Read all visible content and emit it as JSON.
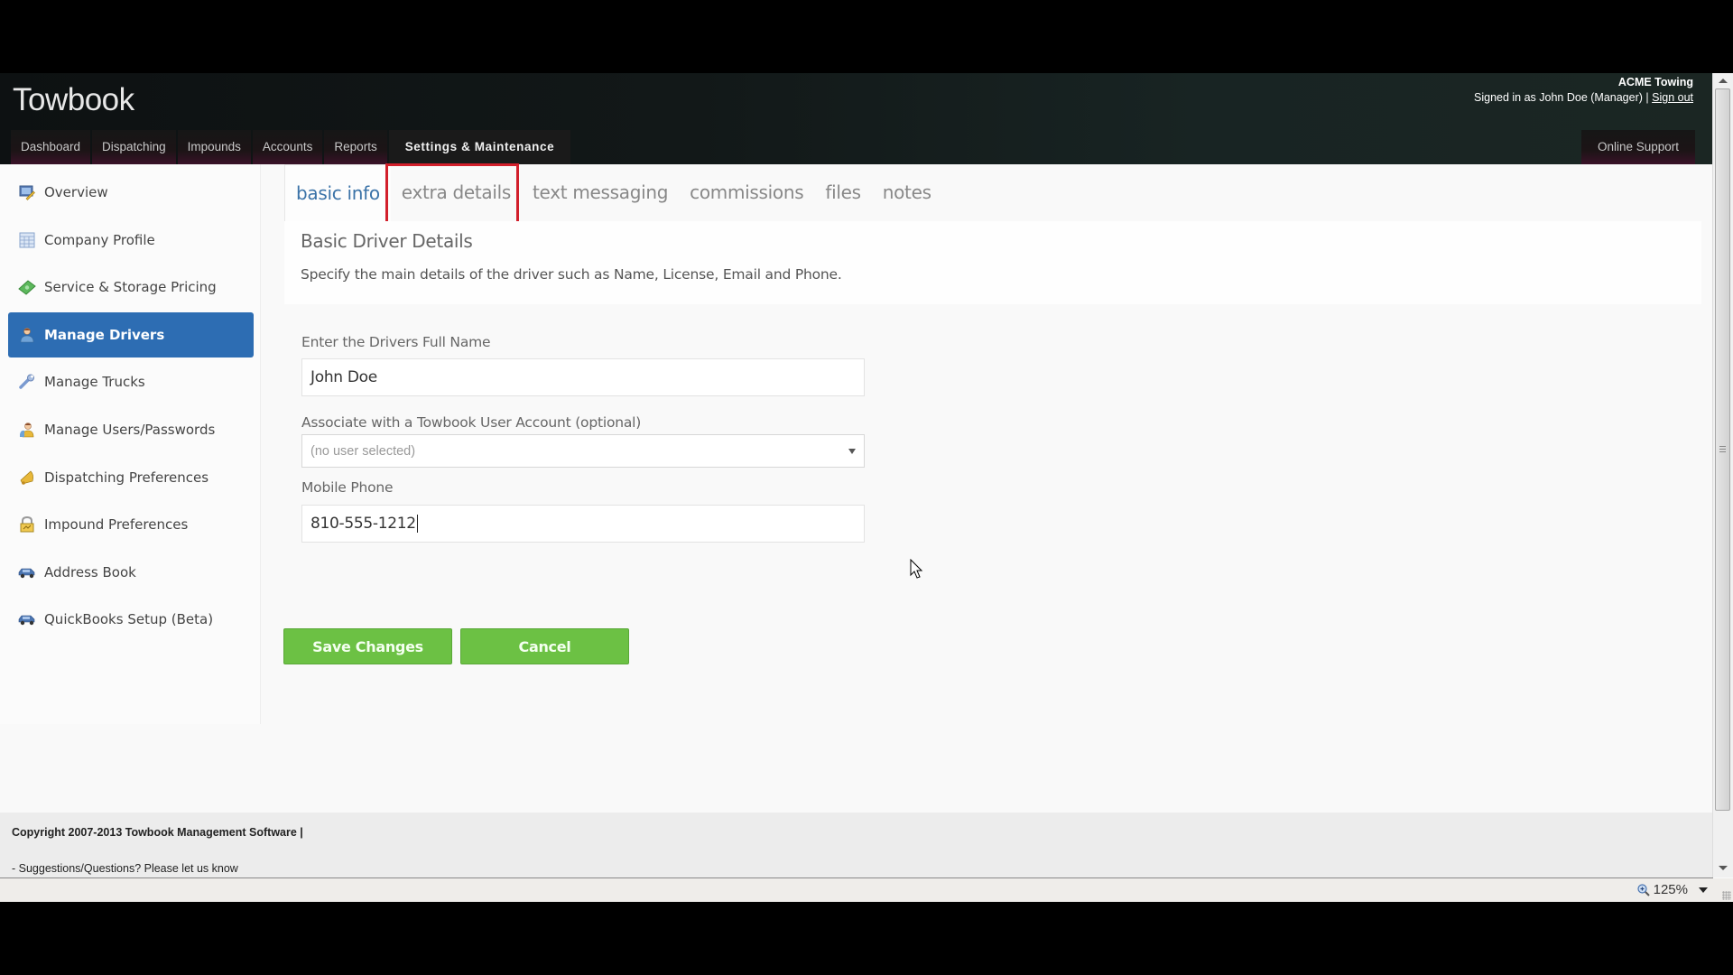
{
  "app": {
    "logo": "Towbook",
    "company": "ACME Towing",
    "signed_in_text": "Signed in as John Doe (Manager) |",
    "sign_out": "Sign out"
  },
  "nav": {
    "tabs": [
      {
        "label": "Dashboard"
      },
      {
        "label": "Dispatching"
      },
      {
        "label": "Impounds"
      },
      {
        "label": "Accounts"
      },
      {
        "label": "Reports"
      },
      {
        "label": "Settings & Maintenance",
        "active": true
      }
    ],
    "support": "Online Support"
  },
  "sidebar": {
    "items": [
      {
        "label": "Overview",
        "icon": "monitor-pencil-icon"
      },
      {
        "label": "Company Profile",
        "icon": "table-icon"
      },
      {
        "label": "Service & Storage Pricing",
        "icon": "money-icon"
      },
      {
        "label": "Manage Drivers",
        "icon": "driver-person-icon",
        "active": true
      },
      {
        "label": "Manage Trucks",
        "icon": "wrench-icon"
      },
      {
        "label": "Manage Users/Passwords",
        "icon": "users-icon"
      },
      {
        "label": "Dispatching Preferences",
        "icon": "bell-icon"
      },
      {
        "label": "Impound Preferences",
        "icon": "lock-icon"
      },
      {
        "label": "Address Book",
        "icon": "car-icon"
      },
      {
        "label": "QuickBooks Setup (Beta)",
        "icon": "car-icon"
      }
    ],
    "active_color": "#2d6db3"
  },
  "tabs": [
    {
      "label": "basic info",
      "active": true
    },
    {
      "label": "extra details",
      "highlighted": true
    },
    {
      "label": "text messaging"
    },
    {
      "label": "commissions"
    },
    {
      "label": "files"
    },
    {
      "label": "notes"
    }
  ],
  "panel": {
    "title": "Basic Driver Details",
    "description": "Specify the main details of the driver such as Name, License, Email and Phone."
  },
  "form": {
    "name_label": "Enter the Drivers Full Name",
    "name_value": "John Doe",
    "user_label": "Associate with a Towbook User Account (optional)",
    "user_value": "(no user selected)",
    "phone_label": "Mobile Phone",
    "phone_value": "810-555-1212"
  },
  "buttons": {
    "save": "Save Changes",
    "cancel": "Cancel",
    "color": "#6cc144"
  },
  "footer": {
    "copyright": "Copyright 2007-2013 Towbook Management Software |",
    "suggestions": "- Suggestions/Questions? Please let us know"
  },
  "statusbar": {
    "zoom": "125%"
  },
  "highlight_color": "#d21f2b"
}
